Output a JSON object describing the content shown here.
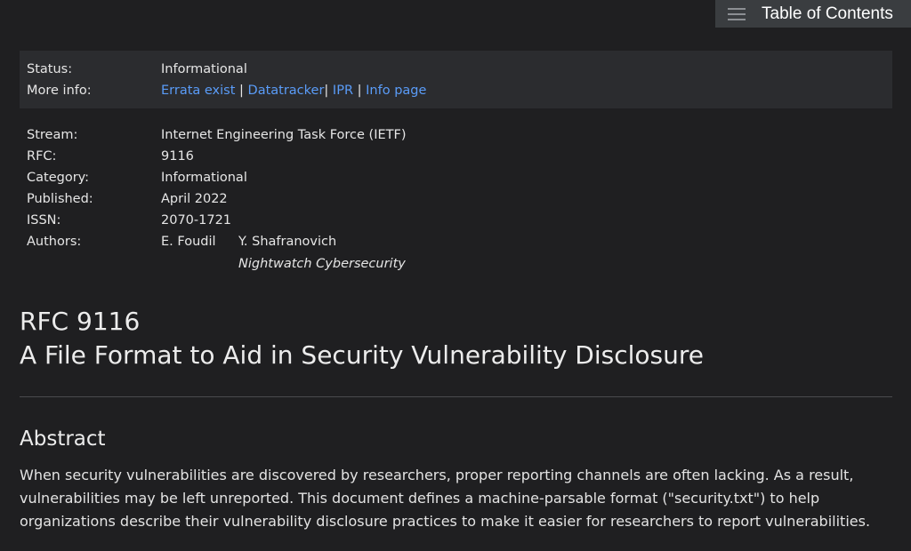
{
  "toc": {
    "label": "Table of Contents",
    "icon": "hamburger-menu-icon"
  },
  "status_box": {
    "status_label": "Status:",
    "status_value": "Informational",
    "more_info_label": "More info:",
    "links": {
      "errata": "Errata exist",
      "datatracker": "Datatracker",
      "ipr": "IPR",
      "info_page": "Info page"
    },
    "separator": "|"
  },
  "meta": {
    "stream_label": "Stream:",
    "stream_value": "Internet Engineering Task Force (IETF)",
    "rfc_label": "RFC:",
    "rfc_value": "9116",
    "category_label": "Category:",
    "category_value": "Informational",
    "published_label": "Published:",
    "published_value": "April 2022",
    "issn_label": "ISSN:",
    "issn_value": "2070-1721",
    "authors_label": "Authors:",
    "author1": "E. Foudil",
    "author2": "Y. Shafranovich",
    "author2_org": "Nightwatch Cybersecurity"
  },
  "title": {
    "rfc_number": "RFC 9116",
    "name": "A File Format to Aid in Security Vulnerability Disclosure"
  },
  "abstract": {
    "heading": "Abstract",
    "text": "When security vulnerabilities are discovered by researchers, proper reporting channels are often lacking. As a result, vulnerabilities may be left unreported. This document defines a machine-parsable format (\"security.txt\") to help organizations describe their vulnerability disclosure practices to make it easier for researchers to report vulnerabilities."
  },
  "colors": {
    "background": "#1f1f21",
    "panel": "#2b2c2f",
    "link": "#5a9cf8",
    "toc_button": "#3a3d40"
  }
}
